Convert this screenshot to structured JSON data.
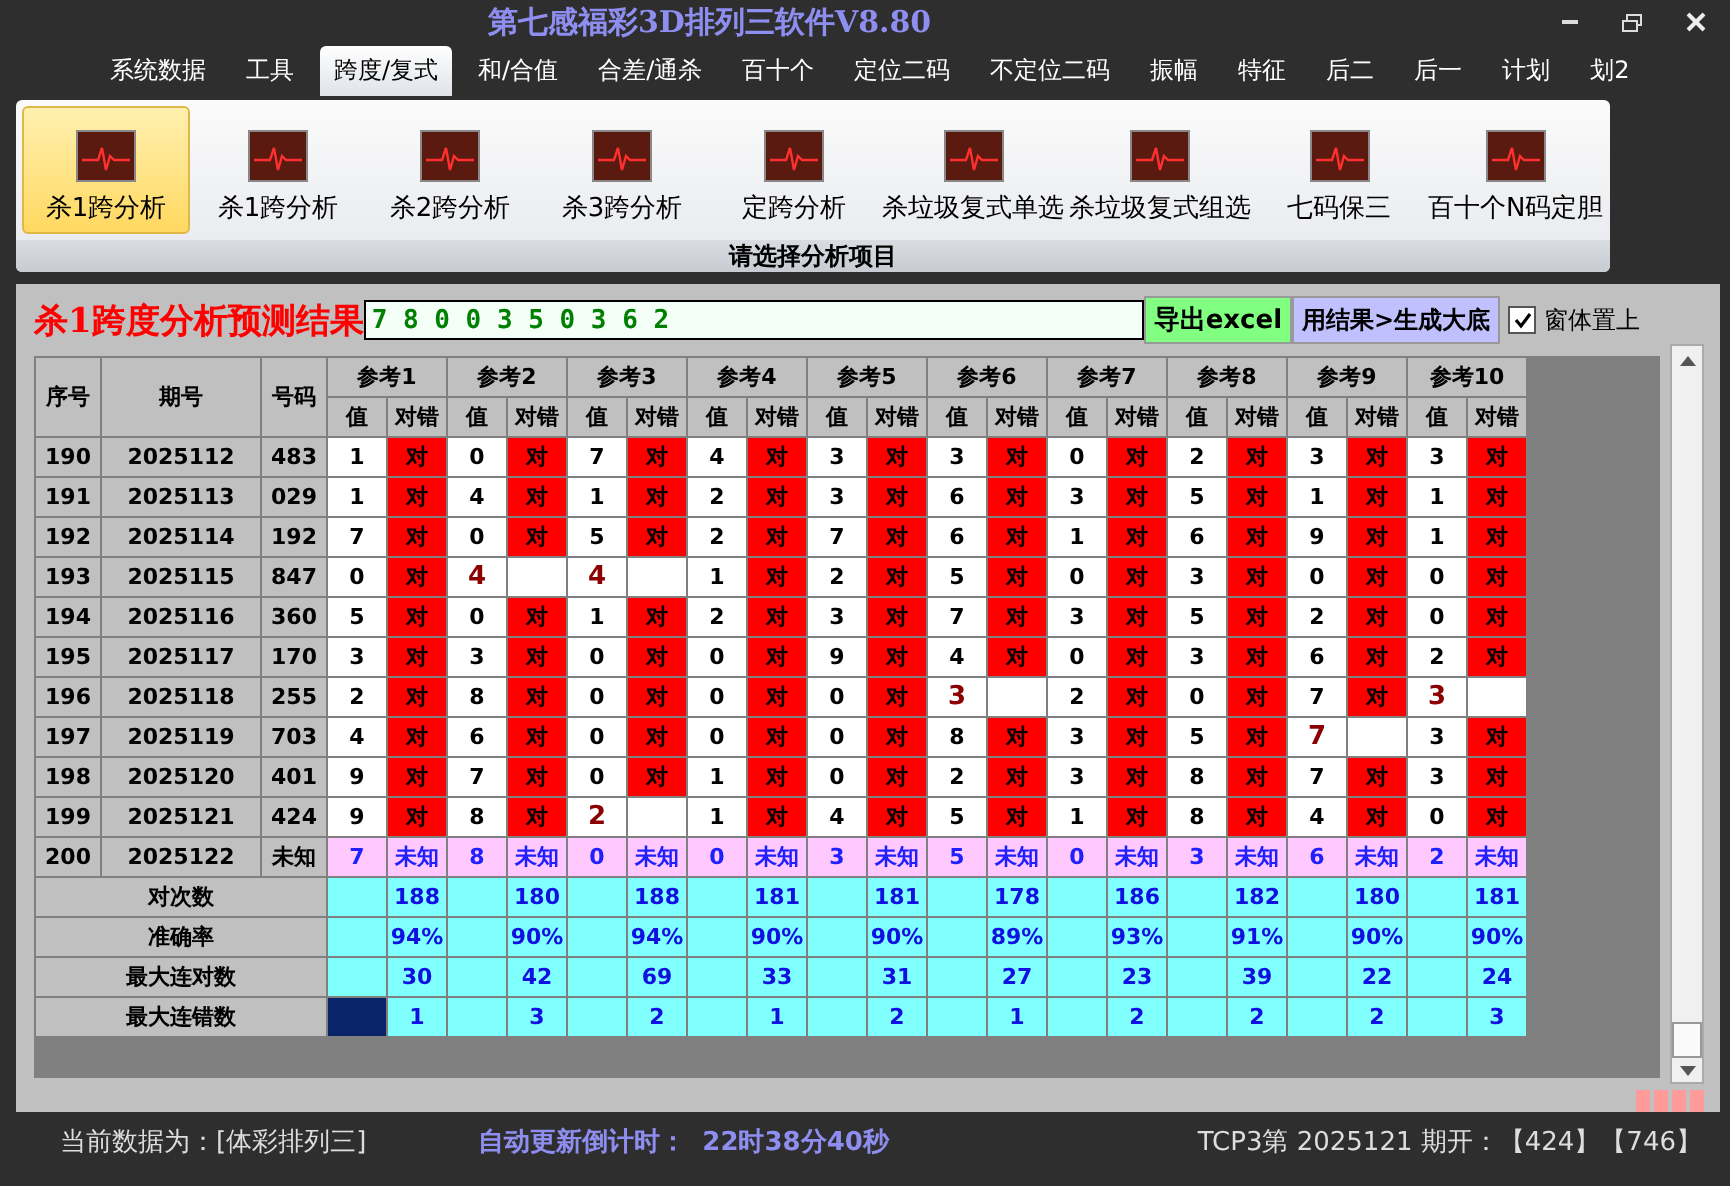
{
  "window": {
    "title": "第七感福彩3D排列三软件V8.80"
  },
  "menu": [
    {
      "label": "系统数据",
      "selected": false
    },
    {
      "label": "工具",
      "selected": false
    },
    {
      "label": "跨度/复式",
      "selected": true
    },
    {
      "label": "和/合值",
      "selected": false
    },
    {
      "label": "合差/通杀",
      "selected": false
    },
    {
      "label": "百十个",
      "selected": false
    },
    {
      "label": "定位二码",
      "selected": false
    },
    {
      "label": "不定位二码",
      "selected": false
    },
    {
      "label": "振幅",
      "selected": false
    },
    {
      "label": "特征",
      "selected": false
    },
    {
      "label": "后二",
      "selected": false
    },
    {
      "label": "后一",
      "selected": false
    },
    {
      "label": "计划",
      "selected": false
    },
    {
      "label": "划2",
      "selected": false
    }
  ],
  "ribbon": {
    "buttons": [
      {
        "label": "杀1跨分析",
        "selected": true
      },
      {
        "label": "杀1跨分析",
        "selected": false
      },
      {
        "label": "杀2跨分析",
        "selected": false
      },
      {
        "label": "杀3跨分析",
        "selected": false
      },
      {
        "label": "定跨分析",
        "selected": false
      },
      {
        "label": "杀垃圾复式单选",
        "selected": false
      },
      {
        "label": "杀垃圾复式组选",
        "selected": false
      },
      {
        "label": "七码保三",
        "selected": false
      },
      {
        "label": "百十个N码定胆",
        "selected": false
      }
    ],
    "group_label": "请选择分析项目"
  },
  "result": {
    "title": "杀1跨度分析预测结果",
    "value": "7 8 0 0 3 5 0 3 6 2",
    "export_button": "导出excel",
    "generate_button": "用结果>生成大底",
    "stay_on_top": {
      "label": "窗体置上",
      "checked": true
    }
  },
  "table": {
    "columns": [
      "序号",
      "期号",
      "号码"
    ],
    "groups": [
      {
        "label": "参考1",
        "sub_columns": [
          "值",
          "对错"
        ]
      },
      {
        "label": "参考2",
        "sub_columns": [
          "值",
          "对错"
        ]
      },
      {
        "label": "参考3",
        "sub_columns": [
          "值",
          "对错"
        ]
      },
      {
        "label": "参考4",
        "sub_columns": [
          "值",
          "对错"
        ]
      },
      {
        "label": "参考5",
        "sub_columns": [
          "值",
          "对错"
        ]
      },
      {
        "label": "参考6",
        "sub_columns": [
          "值",
          "对错"
        ]
      },
      {
        "label": "参考7",
        "sub_columns": [
          "值",
          "对错"
        ]
      },
      {
        "label": "参考8",
        "sub_columns": [
          "值",
          "对错"
        ]
      },
      {
        "label": "参考9",
        "sub_columns": [
          "值",
          "对错"
        ]
      },
      {
        "label": "参考10",
        "sub_columns": [
          "值",
          "对错"
        ]
      }
    ],
    "rows": [
      {
        "kind": "history",
        "seq": "190",
        "period": "2025112",
        "number": "483",
        "refs": [
          {
            "v": "1",
            "r": "对",
            "hit": true
          },
          {
            "v": "0",
            "r": "对",
            "hit": true
          },
          {
            "v": "7",
            "r": "对",
            "hit": true
          },
          {
            "v": "4",
            "r": "对",
            "hit": true
          },
          {
            "v": "3",
            "r": "对",
            "hit": true
          },
          {
            "v": "3",
            "r": "对",
            "hit": true
          },
          {
            "v": "0",
            "r": "对",
            "hit": true
          },
          {
            "v": "2",
            "r": "对",
            "hit": true
          },
          {
            "v": "3",
            "r": "对",
            "hit": true
          },
          {
            "v": "3",
            "r": "对",
            "hit": true
          }
        ]
      },
      {
        "kind": "history",
        "seq": "191",
        "period": "2025113",
        "number": "029",
        "refs": [
          {
            "v": "1",
            "r": "对",
            "hit": true
          },
          {
            "v": "4",
            "r": "对",
            "hit": true
          },
          {
            "v": "1",
            "r": "对",
            "hit": true
          },
          {
            "v": "2",
            "r": "对",
            "hit": true
          },
          {
            "v": "3",
            "r": "对",
            "hit": true
          },
          {
            "v": "6",
            "r": "对",
            "hit": true
          },
          {
            "v": "3",
            "r": "对",
            "hit": true
          },
          {
            "v": "5",
            "r": "对",
            "hit": true
          },
          {
            "v": "1",
            "r": "对",
            "hit": true
          },
          {
            "v": "1",
            "r": "对",
            "hit": true
          }
        ]
      },
      {
        "kind": "history",
        "seq": "192",
        "period": "2025114",
        "number": "192",
        "refs": [
          {
            "v": "7",
            "r": "对",
            "hit": true
          },
          {
            "v": "0",
            "r": "对",
            "hit": true
          },
          {
            "v": "5",
            "r": "对",
            "hit": true
          },
          {
            "v": "2",
            "r": "对",
            "hit": true
          },
          {
            "v": "7",
            "r": "对",
            "hit": true
          },
          {
            "v": "6",
            "r": "对",
            "hit": true
          },
          {
            "v": "1",
            "r": "对",
            "hit": true
          },
          {
            "v": "6",
            "r": "对",
            "hit": true
          },
          {
            "v": "9",
            "r": "对",
            "hit": true
          },
          {
            "v": "1",
            "r": "对",
            "hit": true
          }
        ]
      },
      {
        "kind": "history",
        "seq": "193",
        "period": "2025115",
        "number": "847",
        "refs": [
          {
            "v": "0",
            "r": "对",
            "hit": true
          },
          {
            "v": "4",
            "hit": false
          },
          {
            "v": "4",
            "hit": false
          },
          {
            "v": "1",
            "r": "对",
            "hit": true
          },
          {
            "v": "2",
            "r": "对",
            "hit": true
          },
          {
            "v": "5",
            "r": "对",
            "hit": true
          },
          {
            "v": "0",
            "r": "对",
            "hit": true
          },
          {
            "v": "3",
            "r": "对",
            "hit": true
          },
          {
            "v": "0",
            "r": "对",
            "hit": true
          },
          {
            "v": "0",
            "r": "对",
            "hit": true
          }
        ]
      },
      {
        "kind": "history",
        "seq": "194",
        "period": "2025116",
        "number": "360",
        "refs": [
          {
            "v": "5",
            "r": "对",
            "hit": true
          },
          {
            "v": "0",
            "r": "对",
            "hit": true
          },
          {
            "v": "1",
            "r": "对",
            "hit": true
          },
          {
            "v": "2",
            "r": "对",
            "hit": true
          },
          {
            "v": "3",
            "r": "对",
            "hit": true
          },
          {
            "v": "7",
            "r": "对",
            "hit": true
          },
          {
            "v": "3",
            "r": "对",
            "hit": true
          },
          {
            "v": "5",
            "r": "对",
            "hit": true
          },
          {
            "v": "2",
            "r": "对",
            "hit": true
          },
          {
            "v": "0",
            "r": "对",
            "hit": true
          }
        ]
      },
      {
        "kind": "history",
        "seq": "195",
        "period": "2025117",
        "number": "170",
        "refs": [
          {
            "v": "3",
            "r": "对",
            "hit": true
          },
          {
            "v": "3",
            "r": "对",
            "hit": true
          },
          {
            "v": "0",
            "r": "对",
            "hit": true
          },
          {
            "v": "0",
            "r": "对",
            "hit": true
          },
          {
            "v": "9",
            "r": "对",
            "hit": true
          },
          {
            "v": "4",
            "r": "对",
            "hit": true
          },
          {
            "v": "0",
            "r": "对",
            "hit": true
          },
          {
            "v": "3",
            "r": "对",
            "hit": true
          },
          {
            "v": "6",
            "r": "对",
            "hit": true
          },
          {
            "v": "2",
            "r": "对",
            "hit": true
          }
        ]
      },
      {
        "kind": "history",
        "seq": "196",
        "period": "2025118",
        "number": "255",
        "refs": [
          {
            "v": "2",
            "r": "对",
            "hit": true
          },
          {
            "v": "8",
            "r": "对",
            "hit": true
          },
          {
            "v": "0",
            "r": "对",
            "hit": true
          },
          {
            "v": "0",
            "r": "对",
            "hit": true
          },
          {
            "v": "0",
            "r": "对",
            "hit": true
          },
          {
            "v": "3",
            "hit": false
          },
          {
            "v": "2",
            "r": "对",
            "hit": true
          },
          {
            "v": "0",
            "r": "对",
            "hit": true
          },
          {
            "v": "7",
            "r": "对",
            "hit": true
          },
          {
            "v": "3",
            "hit": false
          }
        ]
      },
      {
        "kind": "history",
        "seq": "197",
        "period": "2025119",
        "number": "703",
        "refs": [
          {
            "v": "4",
            "r": "对",
            "hit": true
          },
          {
            "v": "6",
            "r": "对",
            "hit": true
          },
          {
            "v": "0",
            "r": "对",
            "hit": true
          },
          {
            "v": "0",
            "r": "对",
            "hit": true
          },
          {
            "v": "0",
            "r": "对",
            "hit": true
          },
          {
            "v": "8",
            "r": "对",
            "hit": true
          },
          {
            "v": "3",
            "r": "对",
            "hit": true
          },
          {
            "v": "5",
            "r": "对",
            "hit": true
          },
          {
            "v": "7",
            "hit": false
          },
          {
            "v": "3",
            "r": "对",
            "hit": true
          }
        ]
      },
      {
        "kind": "history",
        "seq": "198",
        "period": "2025120",
        "number": "401",
        "refs": [
          {
            "v": "9",
            "r": "对",
            "hit": true
          },
          {
            "v": "7",
            "r": "对",
            "hit": true
          },
          {
            "v": "0",
            "r": "对",
            "hit": true
          },
          {
            "v": "1",
            "r": "对",
            "hit": true
          },
          {
            "v": "0",
            "r": "对",
            "hit": true
          },
          {
            "v": "2",
            "r": "对",
            "hit": true
          },
          {
            "v": "3",
            "r": "对",
            "hit": true
          },
          {
            "v": "8",
            "r": "对",
            "hit": true
          },
          {
            "v": "7",
            "r": "对",
            "hit": true
          },
          {
            "v": "3",
            "r": "对",
            "hit": true
          }
        ]
      },
      {
        "kind": "history",
        "seq": "199",
        "period": "2025121",
        "number": "424",
        "refs": [
          {
            "v": "9",
            "r": "对",
            "hit": true
          },
          {
            "v": "8",
            "r": "对",
            "hit": true
          },
          {
            "v": "2",
            "hit": false
          },
          {
            "v": "1",
            "r": "对",
            "hit": true
          },
          {
            "v": "4",
            "r": "对",
            "hit": true
          },
          {
            "v": "5",
            "r": "对",
            "hit": true
          },
          {
            "v": "1",
            "r": "对",
            "hit": true
          },
          {
            "v": "8",
            "r": "对",
            "hit": true
          },
          {
            "v": "4",
            "r": "对",
            "hit": true
          },
          {
            "v": "0",
            "r": "对",
            "hit": true
          }
        ]
      },
      {
        "kind": "pending",
        "seq": "200",
        "period": "2025122",
        "number": "未知",
        "refs": [
          {
            "v": "7",
            "r": "未知"
          },
          {
            "v": "8",
            "r": "未知"
          },
          {
            "v": "0",
            "r": "未知"
          },
          {
            "v": "0",
            "r": "未知"
          },
          {
            "v": "3",
            "r": "未知"
          },
          {
            "v": "5",
            "r": "未知"
          },
          {
            "v": "0",
            "r": "未知"
          },
          {
            "v": "3",
            "r": "未知"
          },
          {
            "v": "6",
            "r": "未知"
          },
          {
            "v": "2",
            "r": "未知"
          }
        ]
      }
    ],
    "summary": [
      {
        "label": "对次数",
        "selected": false,
        "values": [
          "188",
          "180",
          "188",
          "181",
          "181",
          "178",
          "186",
          "182",
          "180",
          "181"
        ]
      },
      {
        "label": "准确率",
        "selected": false,
        "values": [
          "94%",
          "90%",
          "94%",
          "90%",
          "90%",
          "89%",
          "93%",
          "91%",
          "90%",
          "90%"
        ]
      },
      {
        "label": "最大连对数",
        "selected": false,
        "values": [
          "30",
          "42",
          "69",
          "33",
          "31",
          "27",
          "23",
          "39",
          "22",
          "24"
        ]
      },
      {
        "label": "最大连错数",
        "selected": true,
        "values": [
          "1",
          "3",
          "2",
          "1",
          "2",
          "1",
          "2",
          "2",
          "2",
          "3"
        ]
      }
    ]
  },
  "status_bar": {
    "data_source": "当前数据为：[体彩排列三]",
    "countdown_label": "自动更新倒计时：",
    "countdown": "22时38分40秒",
    "draw_info": "TCP3第 2025121 期开：【424】【746】"
  }
}
